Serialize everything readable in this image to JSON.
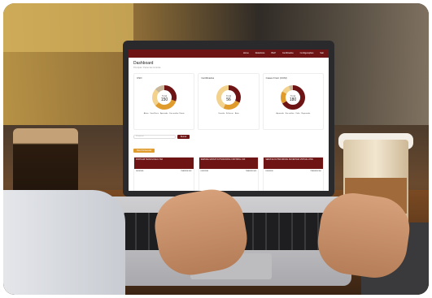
{
  "nav": {
    "items": [
      "Home",
      "Relatórios",
      "BGP",
      "Certificados",
      "Configurações",
      "Sair"
    ]
  },
  "page": {
    "title": "Dashboard",
    "crumb": "Principal / Painel de Controle"
  },
  "cards": [
    {
      "title": "CSO",
      "center_label": "Total",
      "center_value": "150",
      "legend": [
        "Alerta",
        "Sem Risco",
        "Aprovado",
        "Em analise Cliente"
      ],
      "values": [
        45,
        50,
        35,
        20
      ],
      "colors": [
        "#6e1414",
        "#e09b2d",
        "#f3d28e",
        "#c9b89a"
      ]
    },
    {
      "title": "Certificados",
      "center_label": "Total",
      "center_value": "56",
      "legend": [
        "Vencido",
        "A Vencer",
        "Ativo"
      ],
      "values": [
        18,
        14,
        24
      ],
      "colors": [
        "#6e1414",
        "#e09b2d",
        "#f3d28e"
      ]
    },
    {
      "title": "Cases Front (CCM)",
      "center_label": "Total",
      "center_value": "180",
      "legend": [
        "Aprovado",
        "Em análise",
        "Falta",
        "Reprovado"
      ],
      "values": [
        120,
        30,
        20,
        10
      ],
      "colors": [
        "#6e1414",
        "#e09b2d",
        "#f3d28e",
        "#c9b89a"
      ]
    }
  ],
  "search": {
    "placeholder": "Pesquisar",
    "button": "Buscar"
  },
  "new_button": "Novo Fornecedor",
  "tiles": [
    {
      "name": "FORTILAB TECNOLOGIA LTDA",
      "left": "DEFENSE",
      "right": "TRANSFECAO"
    },
    {
      "name": "SERVICE GROUP OUTSOURCING CONTROLL SOI",
      "left": "DEFENSE",
      "right": "TRANSFECAO"
    },
    {
      "name": "SERVICE OUTSOURCING SOCIETDAD VIRTUAL LTDA",
      "left": "DEFENSE",
      "right": "TRANSFECAO"
    }
  ]
}
